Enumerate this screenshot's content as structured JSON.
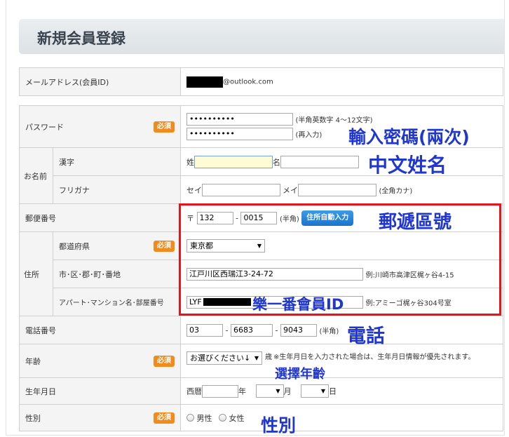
{
  "page_title": "新規会員登録",
  "required_badge": "必須",
  "email": {
    "label": "メールアドレス(会員ID)",
    "domain": "@outlook.com"
  },
  "password": {
    "label": "パスワード",
    "value_masked": "••••••••••",
    "confirm_masked": "••••••••••",
    "hint": "(半角英数字 4～12文字)",
    "confirm_hint": "(再入力)"
  },
  "name": {
    "group_label": "お名前",
    "kanji_label": "漢字",
    "last_prefix": "姓",
    "first_prefix": "名",
    "kana_label": "フリガナ",
    "kana_last_prefix": "セイ",
    "kana_first_prefix": "メイ",
    "kana_hint": "(全角カナ)"
  },
  "postal": {
    "label": "郵便番号",
    "mark": "〒",
    "first": "132",
    "dash": "-",
    "second": "0015",
    "hint": "(半角)",
    "auto_button": "住所自動入力"
  },
  "address": {
    "group_label": "住所",
    "prefecture_label": "都道府県",
    "prefecture_value": "東京都",
    "city_label": "市･区･郡･町･番地",
    "city_value": "江戸川区西瑞江3-24-72",
    "city_example": "例:川崎市高津区梶ヶ谷4-15",
    "building_label": "アパート･マンション名･部屋番号",
    "building_value_prefix": "LYF",
    "building_example": "例:アミーゴ梶ヶ谷304号室"
  },
  "phone": {
    "label": "電話番号",
    "part1": "03",
    "part2": "6683",
    "part3": "9043",
    "dash": "-",
    "hint": "(半角)"
  },
  "age": {
    "label": "年齢",
    "select_value": "お選びください↓",
    "unit": "歳",
    "note": "※生年月日を入力された場合は、生年月日情報が優先されます。"
  },
  "birthdate": {
    "label": "生年月日",
    "era": "西暦",
    "year_unit": "年",
    "month_unit": "月",
    "day_unit": "日"
  },
  "gender": {
    "label": "性別",
    "male": "男性",
    "female": "女性"
  },
  "annotations": {
    "password": "輸入密碼(兩次)",
    "name": "中文姓名",
    "postal": "郵遞區號",
    "member_id": "樂一番會員ID",
    "phone": "電話",
    "age": "選擇年齡",
    "gender": "性別"
  },
  "colors": {
    "required_badge": "#f08c1e",
    "annotation_text": "#1f36d0",
    "highlight_box": "#e8141c",
    "auto_button": "#1b73c9"
  }
}
